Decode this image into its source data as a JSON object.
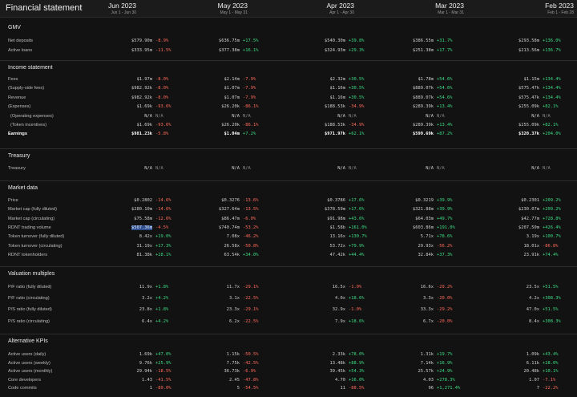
{
  "title": "Financial statement",
  "columns": [
    {
      "month": "Jun 2023",
      "range": "Jun 1 - Jun 30"
    },
    {
      "month": "May 2023",
      "range": "May 1 - May 31"
    },
    {
      "month": "Apr 2023",
      "range": "Apr 1 - Apr 30"
    },
    {
      "month": "Mar 2023",
      "range": "Mar 1 - Mar 31"
    },
    {
      "month": "Feb 2023",
      "range": "Feb 1 - Feb 28"
    }
  ],
  "sections": [
    {
      "title": "GMV",
      "rows": [
        {
          "label": "Net deposits",
          "cells": [
            [
              "$579.90m",
              "-8.9%"
            ],
            [
              "$636.75m",
              "+17.5%"
            ],
            [
              "$540.30m",
              "+39.8%"
            ],
            [
              "$386.55m",
              "+31.7%"
            ],
            [
              "$293.58m",
              "+136.0%"
            ]
          ]
        },
        {
          "label": "Active loans",
          "cells": [
            [
              "$333.95m",
              "-11.5%"
            ],
            [
              "$377.38m",
              "+16.1%"
            ],
            [
              "$324.93m",
              "+29.3%"
            ],
            [
              "$251.38m",
              "+17.7%"
            ],
            [
              "$213.56m",
              "+136.7%"
            ]
          ]
        }
      ]
    },
    {
      "title": "Income statement",
      "rows": [
        {
          "label": "Fees",
          "cells": [
            [
              "$1.97m",
              "-8.0%"
            ],
            [
              "$2.14m",
              "-7.9%"
            ],
            [
              "$2.32m",
              "+30.5%"
            ],
            [
              "$1.78m",
              "+54.6%"
            ],
            [
              "$1.15m",
              "+134.4%"
            ]
          ]
        },
        {
          "label": "(Supply-side fees)",
          "cells": [
            [
              "$982.92k",
              "-8.0%"
            ],
            [
              "$1.07m",
              "-7.9%"
            ],
            [
              "$1.16m",
              "+30.5%"
            ],
            [
              "$889.07k",
              "+54.6%"
            ],
            [
              "$575.47k",
              "+134.4%"
            ]
          ]
        },
        {
          "label": "Revenue",
          "cells": [
            [
              "$982.92k",
              "-8.0%"
            ],
            [
              "$1.07m",
              "-7.9%"
            ],
            [
              "$1.16m",
              "+30.5%"
            ],
            [
              "$889.07k",
              "+54.6%"
            ],
            [
              "$575.47k",
              "+134.4%"
            ]
          ]
        },
        {
          "label": "(Expenses)",
          "cells": [
            [
              "$1.69k",
              "-93.6%"
            ],
            [
              "$26.20k",
              "-86.1%"
            ],
            [
              "$188.53k",
              "-34.9%"
            ],
            [
              "$289.39k",
              "+13.4%"
            ],
            [
              "$255.09k",
              "+82.1%"
            ]
          ]
        },
        {
          "label": "(Operating expenses)",
          "indent": true,
          "cells": [
            [
              "N/A",
              "N/A"
            ],
            [
              "N/A",
              "N/A"
            ],
            [
              "N/A",
              "N/A"
            ],
            [
              "N/A",
              "N/A"
            ],
            [
              "N/A",
              "N/A"
            ]
          ]
        },
        {
          "label": "(Token incentives)",
          "indent": true,
          "cells": [
            [
              "$1.69k",
              "-93.6%"
            ],
            [
              "$26.20k",
              "-86.1%"
            ],
            [
              "$188.53k",
              "-34.9%"
            ],
            [
              "$289.39k",
              "+13.4%"
            ],
            [
              "$255.09k",
              "+82.1%"
            ]
          ]
        },
        {
          "label": "Earnings",
          "bold": true,
          "cells": [
            [
              "$981.23k",
              "-5.8%"
            ],
            [
              "$1.04m",
              "+7.2%"
            ],
            [
              "$971.97k",
              "+62.1%"
            ],
            [
              "$599.69k",
              "+87.2%"
            ],
            [
              "$320.37k",
              "+204.0%"
            ]
          ]
        }
      ]
    },
    {
      "title": "Treasury",
      "rows": [
        {
          "label": "Treasury",
          "cells": [
            [
              "N/A",
              "N/A"
            ],
            [
              "N/A",
              "N/A"
            ],
            [
              "N/A",
              "N/A"
            ],
            [
              "N/A",
              "N/A"
            ],
            [
              "N/A",
              "N/A"
            ]
          ]
        }
      ]
    },
    {
      "title": "Market data",
      "rows": [
        {
          "label": "Price",
          "cells": [
            [
              "$0.2802",
              "-14.6%"
            ],
            [
              "$0.3276",
              "-13.6%"
            ],
            [
              "$0.3786",
              "+17.6%"
            ],
            [
              "$0.3219",
              "+39.9%"
            ],
            [
              "$0.2301",
              "+209.2%"
            ]
          ]
        },
        {
          "label": "Market cap (fully diluted)",
          "cells": [
            [
              "$280.10m",
              "-14.6%"
            ],
            [
              "$327.64m",
              "-13.5%"
            ],
            [
              "$378.59m",
              "+17.6%"
            ],
            [
              "$321.88m",
              "+39.9%"
            ],
            [
              "$230.07m",
              "+209.2%"
            ]
          ]
        },
        {
          "label": "Market cap (circulating)",
          "cells": [
            [
              "$75.58m",
              "-12.6%"
            ],
            [
              "$86.47m",
              "-6.0%"
            ],
            [
              "$91.98m",
              "+43.6%"
            ],
            [
              "$64.03m",
              "+49.7%"
            ],
            [
              "$42.77m",
              "+728.8%"
            ]
          ]
        },
        {
          "label": "RDNT trading volume",
          "highlight": true,
          "cells": [
            [
              "$507.36m",
              "-4.5%"
            ],
            [
              "$740.74m",
              "-53.2%"
            ],
            [
              "$1.58b",
              "+161.0%"
            ],
            [
              "$603.86m",
              "+191.0%"
            ],
            [
              "$207.50m",
              "+426.4%"
            ]
          ]
        },
        {
          "label": "Token turnover (fully diluted)",
          "cells": [
            [
              "8.42x",
              "+19.0%"
            ],
            [
              "7.08x",
              "-46.2%"
            ],
            [
              "13.16x",
              "+130.7%"
            ],
            [
              "5.71x",
              "+78.6%"
            ],
            [
              "3.19x",
              "+100.7%"
            ]
          ]
        },
        {
          "label": "Token turnover (circulating)",
          "cells": [
            [
              "31.19x",
              "+17.3%"
            ],
            [
              "26.58x",
              "-50.8%"
            ],
            [
              "53.72x",
              "+79.9%"
            ],
            [
              "29.93x",
              "-56.2%"
            ],
            [
              "18.01x",
              "-86.8%"
            ]
          ]
        },
        {
          "label": "RDNT tokenholders",
          "cells": [
            [
              "81.38k",
              "+28.1%"
            ],
            [
              "63.54k",
              "+34.0%"
            ],
            [
              "47.42k",
              "+44.4%"
            ],
            [
              "32.84k",
              "+37.3%"
            ],
            [
              "23.91k",
              "+74.4%"
            ]
          ]
        }
      ]
    },
    {
      "title": "Valuation multiples",
      "rows": [
        {
          "label": "P/F ratio (fully diluted)",
          "cells": [
            [
              "11.9x",
              "+1.8%"
            ],
            [
              "11.7x",
              "-29.1%"
            ],
            [
              "16.5x",
              "-1.0%"
            ],
            [
              "16.6x",
              "-29.2%"
            ],
            [
              "23.5x",
              "+51.5%"
            ]
          ]
        },
        {
          "label": "P/F ratio (circulating)",
          "cells": [
            [
              "3.2x",
              "+4.2%"
            ],
            [
              "3.1x",
              "-22.5%"
            ],
            [
              "4.0x",
              "+18.6%"
            ],
            [
              "3.3x",
              "-20.0%"
            ],
            [
              "4.2x",
              "+308.3%"
            ]
          ]
        },
        {
          "label": "P/S ratio (fully diluted)",
          "cells": [
            [
              "23.8x",
              "+1.8%"
            ],
            [
              "23.3x",
              "-29.1%"
            ],
            [
              "32.9x",
              "-1.0%"
            ],
            [
              "33.3x",
              "-29.2%"
            ],
            [
              "47.0x",
              "+51.5%"
            ]
          ]
        },
        {
          "label": "P/S ratio (circulating)",
          "cells": [
            [
              "6.4x",
              "+4.2%"
            ],
            [
              "6.2x",
              "-22.5%"
            ],
            [
              "7.9x",
              "+18.6%"
            ],
            [
              "6.7x",
              "-20.0%"
            ],
            [
              "8.4x",
              "+308.3%"
            ]
          ]
        }
      ]
    },
    {
      "title": "Alternative KPIs",
      "rows": [
        {
          "label": "Active users (daily)",
          "cells": [
            [
              "1.69k",
              "+47.0%"
            ],
            [
              "1.15k",
              "-50.5%"
            ],
            [
              "2.33k",
              "+78.0%"
            ],
            [
              "1.31k",
              "+19.7%"
            ],
            [
              "1.09k",
              "+43.4%"
            ]
          ]
        },
        {
          "label": "Active users (weekly)",
          "cells": [
            [
              "9.76k",
              "+25.9%"
            ],
            [
              "7.75k",
              "-42.5%"
            ],
            [
              "13.48k",
              "+88.9%"
            ],
            [
              "7.14k",
              "+16.9%"
            ],
            [
              "6.11k",
              "+28.0%"
            ]
          ]
        },
        {
          "label": "Active users (monthly)",
          "cells": [
            [
              "29.94k",
              "-18.5%"
            ],
            [
              "36.73k",
              "-6.9%"
            ],
            [
              "39.45k",
              "+54.3%"
            ],
            [
              "25.57k",
              "+24.9%"
            ],
            [
              "20.48k",
              "+10.1%"
            ]
          ]
        },
        {
          "label": "Core developers",
          "cells": [
            [
              "1.43",
              "-41.5%"
            ],
            [
              "2.45",
              "-47.8%"
            ],
            [
              "4.70",
              "+16.0%"
            ],
            [
              "4.03",
              "+278.3%"
            ],
            [
              "1.07",
              "-7.1%"
            ]
          ]
        },
        {
          "label": "Code commits",
          "cells": [
            [
              "1",
              "-80.0%"
            ],
            [
              "5",
              "-54.5%"
            ],
            [
              "11",
              "-88.5%"
            ],
            [
              "96",
              "+1,271.4%"
            ],
            [
              "7",
              "-22.2%"
            ]
          ]
        }
      ]
    }
  ]
}
